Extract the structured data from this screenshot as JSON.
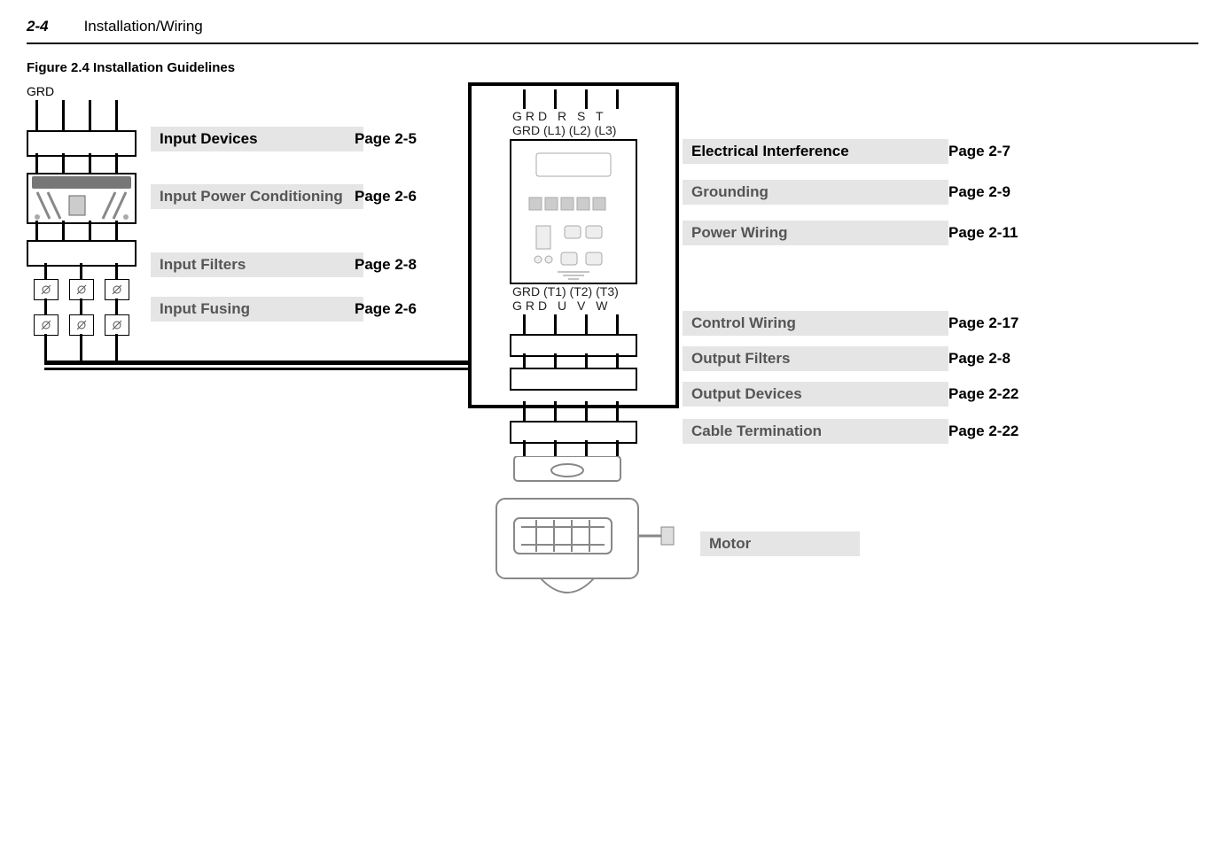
{
  "header": {
    "page": "2-4",
    "section": "Installation/Wiring"
  },
  "figure_title": "Figure 2.4  Installation Guidelines",
  "labels": {
    "grd": "GRD",
    "top_terms": "GRD   R     S     T",
    "top_terms2": "GRD (L1) (L2) (L3)",
    "bot_terms": "GRD (T1) (T2) (T3)",
    "bot_terms2": "GRD  U     V     W"
  },
  "left_callouts": [
    {
      "title": "Input Devices",
      "page": "Page 2-5"
    },
    {
      "title": "Input Power Conditioning",
      "page": "Page 2-6"
    },
    {
      "title": "Input Filters",
      "page": "Page 2-8"
    },
    {
      "title": "Input Fusing",
      "page": "Page 2-6"
    }
  ],
  "right_callouts": [
    {
      "title": "Electrical Interference",
      "page": "Page 2-7"
    },
    {
      "title": "Grounding",
      "page": "Page 2-9"
    },
    {
      "title": "Power Wiring",
      "page": "Page 2-11"
    },
    {
      "title": "Control Wiring",
      "page": "Page 2-17"
    },
    {
      "title": "Output Filters",
      "page": "Page 2-8"
    },
    {
      "title": "Output Devices",
      "page": "Page 2-22"
    },
    {
      "title": "Cable Termination",
      "page": "Page 2-22"
    }
  ],
  "motor": "Motor"
}
